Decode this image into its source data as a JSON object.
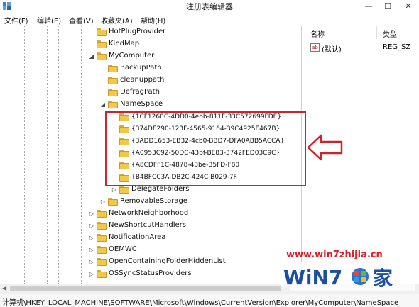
{
  "window": {
    "title": "注册表编辑器",
    "minimize": "—",
    "maximize": "☐",
    "close": "✕"
  },
  "menu": [
    "文件(F)",
    "编辑(E)",
    "查看(V)",
    "收藏夹(A)",
    "帮助(H)"
  ],
  "tree": [
    {
      "label": "HotPlugProvider",
      "expander": ""
    },
    {
      "label": "KindMap",
      "expander": ""
    },
    {
      "label": "MyComputer",
      "expander": "◢"
    },
    {
      "label": "BackupPath",
      "expander": ""
    },
    {
      "label": "cleanuppath",
      "expander": ""
    },
    {
      "label": "DefragPath",
      "expander": ""
    },
    {
      "label": "NameSpace",
      "expander": "◢"
    },
    {
      "label": "{1CF1260C-4DD0-4ebb-811F-33C572699FDE}",
      "expander": ""
    },
    {
      "label": "{374DE290-123F-4565-9164-39C4925E467B}",
      "expander": ""
    },
    {
      "label": "{3ADD1653-EB32-4cb0-BBD7-DFA0ABB5ACCA}",
      "expander": ""
    },
    {
      "label": "{A0953C92-50DC-43bf-BE83-3742FED03C9C}",
      "expander": ""
    },
    {
      "label": "{A8CDFF1C-4878-43be-B5FD-F80",
      "expander": ""
    },
    {
      "label": "{B4BFCC3A-DB2C-424C-B029-7F",
      "expander": ""
    },
    {
      "label": "DelegateFolders",
      "expander": "▷"
    },
    {
      "label": "RemovableStorage",
      "expander": "▷"
    },
    {
      "label": "NetworkNeighborhood",
      "expander": "▷"
    },
    {
      "label": "NewShortcutHandlers",
      "expander": "▷"
    },
    {
      "label": "NotificationArea",
      "expander": "▷"
    },
    {
      "label": "OEMWC",
      "expander": "▷"
    },
    {
      "label": "OpenContainingFolderHiddenList",
      "expander": "▷"
    },
    {
      "label": "OSSyncStatusProviders",
      "expander": "▷"
    }
  ],
  "values": {
    "col_name": "名称",
    "col_type": "类型",
    "rows": [
      {
        "icon": "ab",
        "name": "(默认)",
        "type": "REG_SZ"
      }
    ]
  },
  "status": "计算机\\HKEY_LOCAL_MACHINE\\SOFTWARE\\Microsoft\\Windows\\CurrentVersion\\Explorer\\MyComputer\\NameSpace",
  "watermark": {
    "url": "www.win7zhijia.cn",
    "brand": "WiN7",
    "suffix": "家"
  },
  "colors": {
    "highlight": "#c8262f",
    "folder": "#f2c84b"
  }
}
